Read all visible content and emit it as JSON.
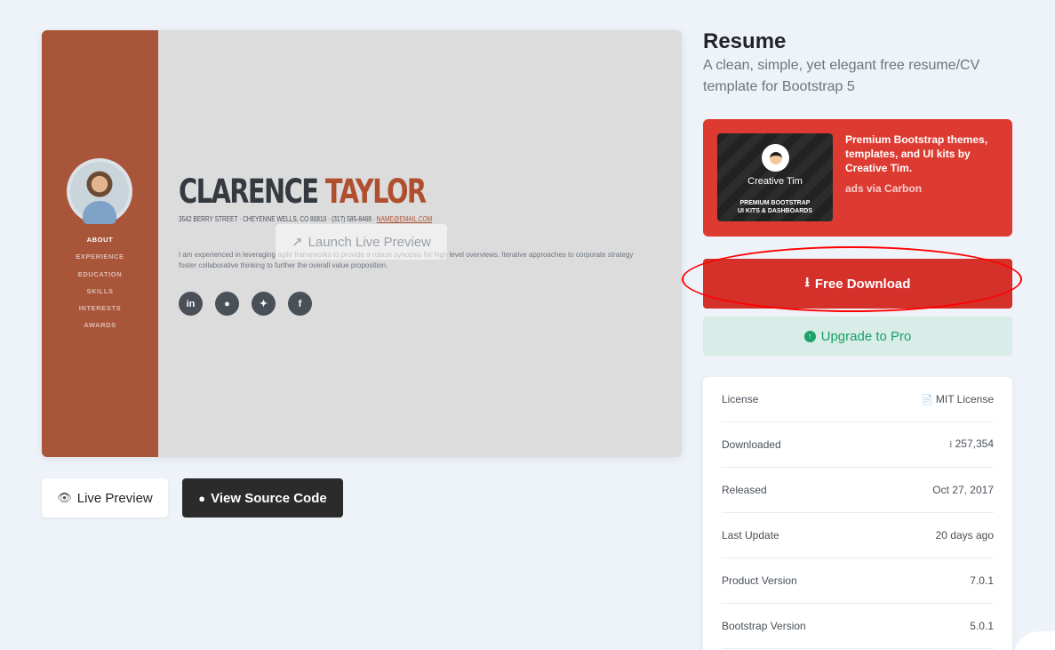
{
  "preview": {
    "side_nav": [
      "ABOUT",
      "EXPERIENCE",
      "EDUCATION",
      "SKILLS",
      "INTERESTS",
      "AWARDS"
    ],
    "first_name": "CLARENCE",
    "last_name": "TAYLOR",
    "address": "3542 BERRY STREET · CHEYENNE WELLS, CO 80810 · (317) 585-8468 · ",
    "email": "NAME@EMAIL.COM",
    "bio": "I am experienced in leveraging agile frameworks to provide a robust synopsis for high level overviews. Iterative approaches to corporate strategy foster collaborative thinking to further the overall value proposition.",
    "social_icons": [
      "linkedin-icon",
      "github-icon",
      "twitter-icon",
      "facebook-icon"
    ],
    "launch_label": "Launch Live Preview"
  },
  "buttons": {
    "live_preview": "Live Preview",
    "view_source": "View Source Code",
    "free_download": "Free Download",
    "upgrade_pro": "Upgrade to Pro"
  },
  "product": {
    "title": "Resume",
    "subtitle": "A clean, simple, yet elegant free resume/CV template for Bootstrap 5"
  },
  "ad": {
    "brand": "Creative Tim",
    "tagline_1": "PREMIUM BOOTSTRAP",
    "tagline_2": "UI KITS & DASHBOARDS",
    "text": "Premium Bootstrap themes, templates, and UI kits by Creative Tim.",
    "via": "ads via Carbon"
  },
  "info": {
    "license_label": "License",
    "license_value": "MIT License",
    "downloaded_label": "Downloaded",
    "downloaded_value": "257,354",
    "released_label": "Released",
    "released_value": "Oct 27, 2017",
    "last_update_label": "Last Update",
    "last_update_value": "20 days ago",
    "product_version_label": "Product Version",
    "product_version_value": "7.0.1",
    "bootstrap_version_label": "Bootstrap Version",
    "bootstrap_version_value": "5.0.1"
  },
  "colors": {
    "accent": "#a9553a",
    "download": "#d3312a",
    "ad": "#dd3b32",
    "pro": "#1aa068"
  }
}
